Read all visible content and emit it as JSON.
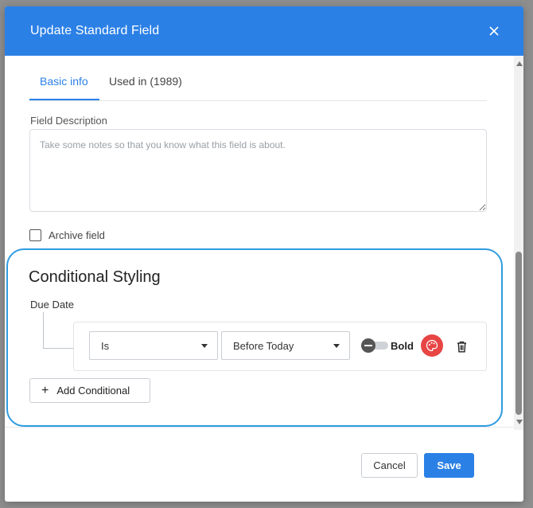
{
  "dialog": {
    "title": "Update Standard Field",
    "close_icon": "close-icon"
  },
  "tabs": [
    {
      "label": "Basic info",
      "active": true
    },
    {
      "label": "Used in (1989)",
      "active": false
    }
  ],
  "description": {
    "label": "Field Description",
    "placeholder": "Take some notes so that you know what this field is about.",
    "value": ""
  },
  "archive": {
    "label": "Archive field",
    "checked": false
  },
  "conditional_styling": {
    "title": "Conditional Styling",
    "field_label": "Due Date",
    "rules": [
      {
        "operator": "Is",
        "value": "Before Today",
        "bold_label": "Bold",
        "bold_enabled": false,
        "color": "#e84545"
      }
    ],
    "add_label": "Add Conditional"
  },
  "footer": {
    "cancel_label": "Cancel",
    "save_label": "Save"
  },
  "colors": {
    "accent": "#2b80e6",
    "highlight_border": "#2f9be0",
    "rule_color": "#e84545"
  }
}
